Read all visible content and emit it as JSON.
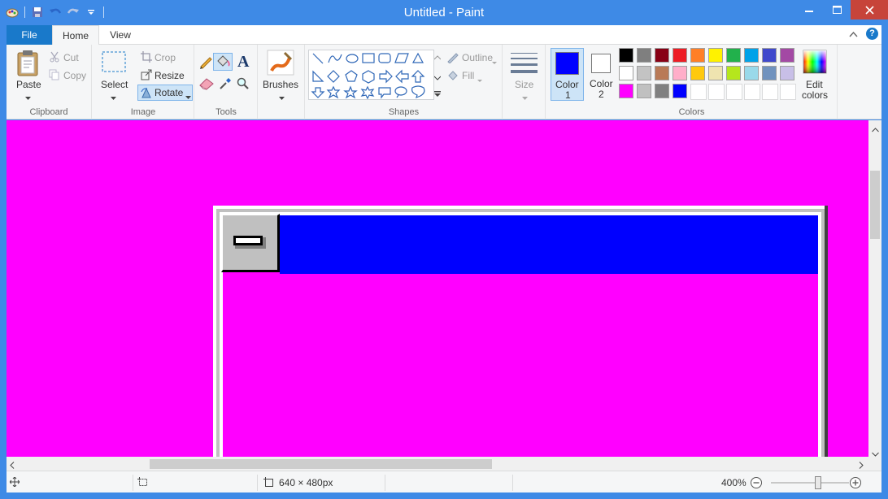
{
  "title": "Untitled - Paint",
  "menu": {
    "file": "File",
    "home": "Home",
    "view": "View"
  },
  "clipboard": {
    "paste": "Paste",
    "cut": "Cut",
    "copy": "Copy",
    "group": "Clipboard"
  },
  "image": {
    "select": "Select",
    "crop": "Crop",
    "resize": "Resize",
    "rotate": "Rotate",
    "group": "Image"
  },
  "tools": {
    "group": "Tools"
  },
  "brushes": {
    "label": "Brushes"
  },
  "shapes": {
    "outline": "Outline",
    "fill": "Fill",
    "group": "Shapes"
  },
  "size": {
    "label": "Size"
  },
  "colors": {
    "color1_label": "Color",
    "color1_num": "1",
    "color2_label": "Color",
    "color2_num": "2",
    "color1": "#0000ff",
    "color2": "#ffffff",
    "edit_label": "Edit",
    "edit_label2": "colors",
    "group": "Colors",
    "palette_row1": [
      "#000000",
      "#7f7f7f",
      "#880015",
      "#ed1c24",
      "#ff7f27",
      "#fff200",
      "#22b14c",
      "#00a2e8",
      "#3f48cc",
      "#a349a4"
    ],
    "palette_row2": [
      "#ffffff",
      "#c3c3c3",
      "#b97a57",
      "#ffaec9",
      "#ffc90e",
      "#efe4b0",
      "#b5e61d",
      "#99d9ea",
      "#7092be",
      "#c8bfe7"
    ],
    "palette_row3": [
      "#ff00ff",
      "#c0c0c0",
      "#808080",
      "#0000ff"
    ]
  },
  "canvas": {
    "background": "#ff00ff",
    "inner_titlebar": "#0000ff"
  },
  "status": {
    "dimensions": "640 × 480px",
    "zoom": "400%"
  }
}
